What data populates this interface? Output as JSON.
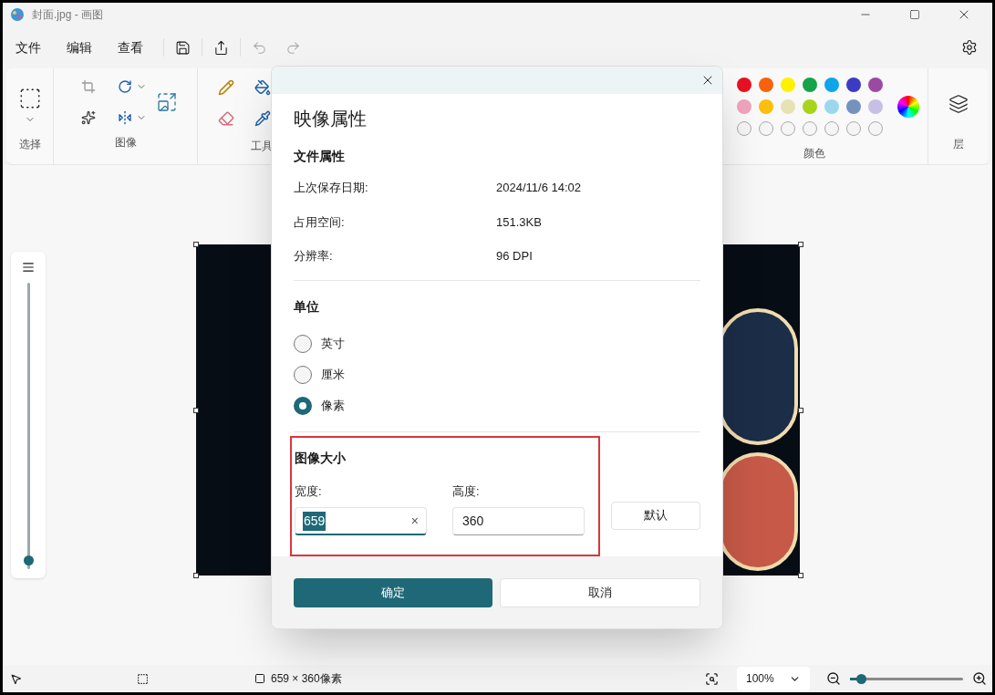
{
  "window": {
    "title": "封面.jpg - 画图"
  },
  "menu": [
    "文件",
    "编辑",
    "查看"
  ],
  "ribbon": {
    "groups": [
      "选择",
      "图像",
      "工具",
      "颜色",
      "层"
    ],
    "swatches": [
      {
        "kind": "filled",
        "color": "#e81123"
      },
      {
        "kind": "filled",
        "color": "#f7630c"
      },
      {
        "kind": "filled",
        "color": "#fff100"
      },
      {
        "kind": "filled",
        "color": "#16a34a"
      },
      {
        "kind": "filled",
        "color": "#0ea5e9"
      },
      {
        "kind": "filled",
        "color": "#3b3bc4"
      },
      {
        "kind": "filled",
        "color": "#9b4aa3"
      },
      {
        "kind": "filled",
        "color": "#f0a3bd"
      },
      {
        "kind": "filled",
        "color": "#fbbf0c"
      },
      {
        "kind": "filled",
        "color": "#e5e3b3"
      },
      {
        "kind": "filled",
        "color": "#a8d41c"
      },
      {
        "kind": "filled",
        "color": "#9bd8ee"
      },
      {
        "kind": "filled",
        "color": "#7392be"
      },
      {
        "kind": "filled",
        "color": "#c8bfe5"
      },
      {
        "kind": "empty"
      },
      {
        "kind": "empty"
      },
      {
        "kind": "empty"
      },
      {
        "kind": "empty"
      },
      {
        "kind": "empty"
      },
      {
        "kind": "empty"
      },
      {
        "kind": "empty"
      }
    ]
  },
  "brush_slider": {
    "level": 0.03
  },
  "dialog": {
    "title": "映像属性",
    "file_section": "文件属性",
    "properties": [
      {
        "label": "上次保存日期:",
        "value": "2024/11/6 14:02"
      },
      {
        "label": "占用空间:",
        "value": "151.3KB"
      },
      {
        "label": "分辨率:",
        "value": "96 DPI"
      }
    ],
    "unit_section": "单位",
    "units": [
      {
        "label": "英寸",
        "selected": false
      },
      {
        "label": "厘米",
        "selected": false
      },
      {
        "label": "像素",
        "selected": true
      }
    ],
    "size_section": "图像大小",
    "width": {
      "label": "宽度:",
      "value": "659",
      "clear": "×"
    },
    "height": {
      "label": "高度:",
      "value": "360"
    },
    "default_button": "默认",
    "ok_button": "确定",
    "cancel_button": "取消"
  },
  "status_bar": {
    "size": "659 × 360像素",
    "zoom": "100%",
    "zoom_level": {
      "level": 0.1
    }
  }
}
